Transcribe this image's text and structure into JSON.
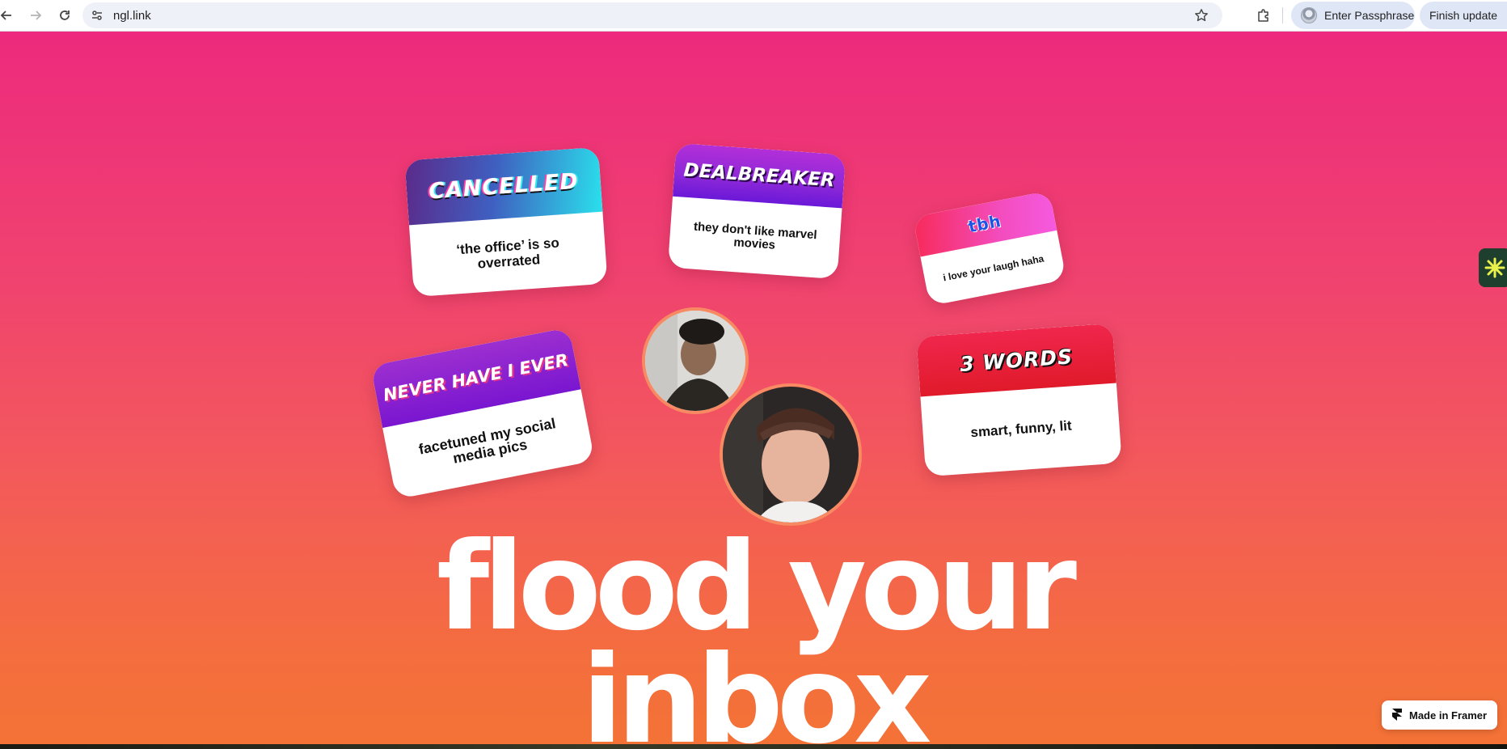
{
  "browser": {
    "url": "ngl.link",
    "profile_label": "Enter Passphrase",
    "update_label": "Finish update"
  },
  "cards": [
    {
      "header": "CANCELLED",
      "body": "‘the office’ is so overrated"
    },
    {
      "header": "DEALBREAKER",
      "body": "they don't like marvel movies"
    },
    {
      "header": "tbh",
      "body": "i love your laugh haha"
    },
    {
      "header": "NEVER HAVE I EVER",
      "body": "facetuned my social media pics"
    },
    {
      "header": "3 WORDS",
      "body": "smart, funny, lit"
    }
  ],
  "hero": {
    "line1": "flood your",
    "line2": "inbox"
  },
  "framer_badge": "Made in Framer",
  "colors": {
    "gradient_top": "#ed2a7d",
    "gradient_bottom": "#f47236",
    "cancelled_header_from": "#5b2a8a",
    "cancelled_header_to": "#2ae0ec",
    "dealbreaker_header": "#8d28d8",
    "tbh_header": "#f34cbd",
    "never_header": "#7a16d0",
    "three_words_header": "#e01a2a"
  }
}
